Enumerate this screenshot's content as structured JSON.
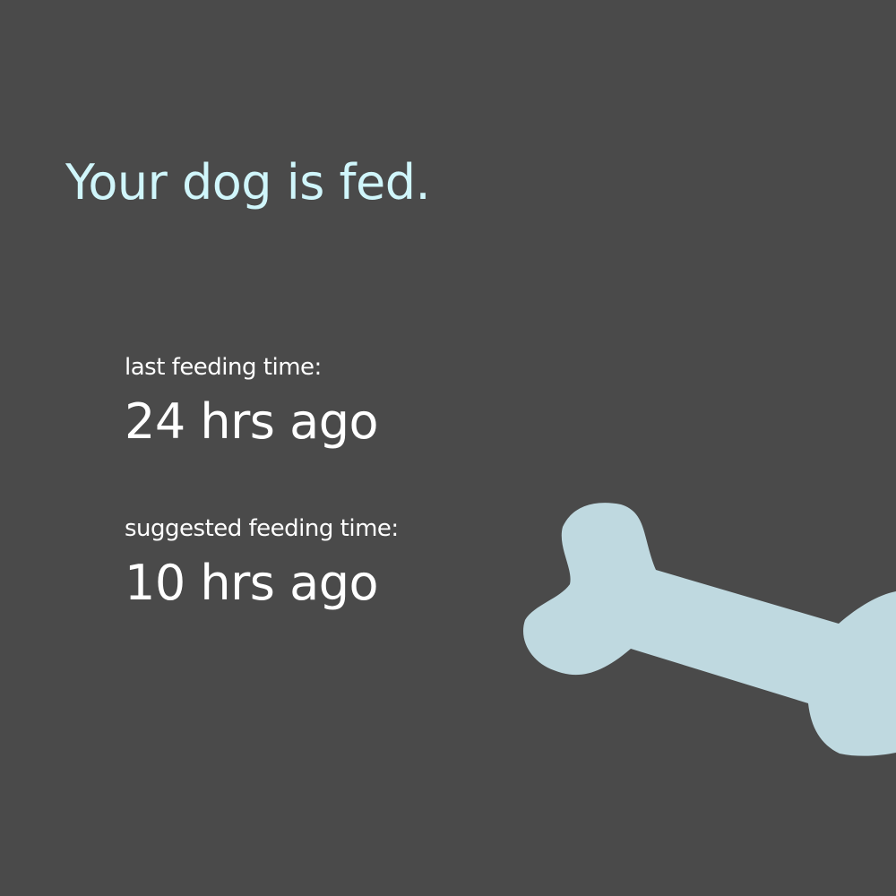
{
  "status": {
    "title": "Your dog is fed."
  },
  "last_feeding": {
    "label": "last feeding time:",
    "value": "24 hrs ago"
  },
  "suggested_feeding": {
    "label": "suggested feeding time:",
    "value": "10 hrs ago"
  },
  "decoration": {
    "icon": "bone-icon",
    "color": "#bfd9e0"
  },
  "colors": {
    "background": "#4a4a4a",
    "title": "#d0f6fb",
    "text": "#ffffff"
  }
}
